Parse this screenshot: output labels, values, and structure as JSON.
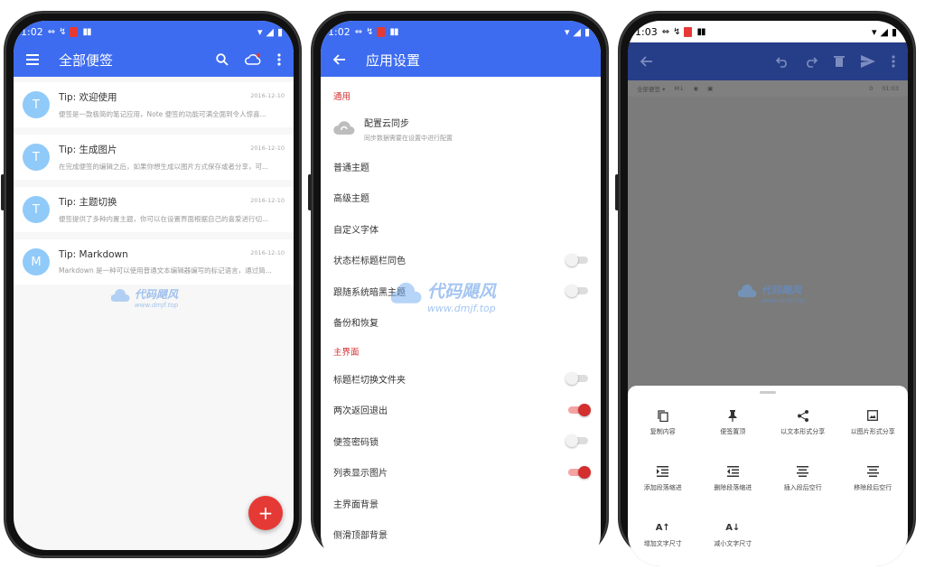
{
  "phones": {
    "notes": {
      "status": {
        "time": "1:02"
      },
      "appbar": {
        "title": "全部便签"
      },
      "notes": [
        {
          "avatar": "T",
          "title": "Tip: 欢迎使用",
          "date": "2016-12-10",
          "preview": "便签是一款极简的笔记应用，Note 便签的功能可满全面到令人惊喜..."
        },
        {
          "avatar": "T",
          "title": "Tip: 生成图片",
          "date": "2016-12-10",
          "preview": "在完成便签的编辑之后，如果你想生成以图片方式保存或者分享，可..."
        },
        {
          "avatar": "T",
          "title": "Tip: 主题切换",
          "date": "2016-12-10",
          "preview": "便签提供了多种内置主题，你可以在设置界面根据自己的喜爱进行切..."
        },
        {
          "avatar": "M",
          "title": "Tip: Markdown",
          "date": "2016-12-10",
          "preview": "Markdown 是一种可以使用普通文本编辑器编写的标记语言，通过简..."
        }
      ],
      "fab": "+"
    },
    "settings": {
      "status": {
        "time": "1:02"
      },
      "appbar": {
        "title": "应用设置"
      },
      "sections": {
        "general": "通用",
        "main": "主界面"
      },
      "cloud": {
        "title": "配置云同步",
        "subtitle": "同步数据需要在设置中进行配置"
      },
      "general_items": [
        {
          "label": "普通主题"
        },
        {
          "label": "高级主题"
        },
        {
          "label": "自定义字体"
        },
        {
          "label": "状态栏标题栏同色",
          "toggle": false
        },
        {
          "label": "跟随系统暗黑主题",
          "toggle": false
        },
        {
          "label": "备份和恢复"
        }
      ],
      "main_items": [
        {
          "label": "标题栏切换文件夹",
          "toggle": false
        },
        {
          "label": "两次返回退出",
          "toggle": true
        },
        {
          "label": "便签密码锁",
          "toggle": false
        },
        {
          "label": "列表显示图片",
          "toggle": true
        },
        {
          "label": "主界面背景"
        },
        {
          "label": "侧滑顶部背景"
        }
      ]
    },
    "editor": {
      "status": {
        "time": "1:03"
      },
      "subbar": {
        "folder": "全部便签 ▾",
        "md": "M↓",
        "count": "0",
        "time": "01:03"
      },
      "actions": [
        {
          "label": "复制内容",
          "icon": "copy-icon"
        },
        {
          "label": "便签置顶",
          "icon": "pin-icon"
        },
        {
          "label": "以文本形式分享",
          "icon": "share-icon"
        },
        {
          "label": "以图片形式分享",
          "icon": "image-icon"
        },
        {
          "label": "添加段落缩进",
          "icon": "indent-increase-icon"
        },
        {
          "label": "删除段落缩进",
          "icon": "indent-decrease-icon"
        },
        {
          "label": "插入段后空行",
          "icon": "insert-line-icon"
        },
        {
          "label": "移除段后空行",
          "icon": "remove-line-icon"
        },
        {
          "label": "增加文字尺寸",
          "icon": "text-increase-icon"
        },
        {
          "label": "减小文字尺寸",
          "icon": "text-decrease-icon"
        }
      ]
    }
  },
  "watermark": {
    "brand": "代码飓风",
    "url": "www.dmjf.top"
  },
  "colors": {
    "primary": "#3d6cf0",
    "accent": "#e53935",
    "dark_primary": "#263d88"
  }
}
